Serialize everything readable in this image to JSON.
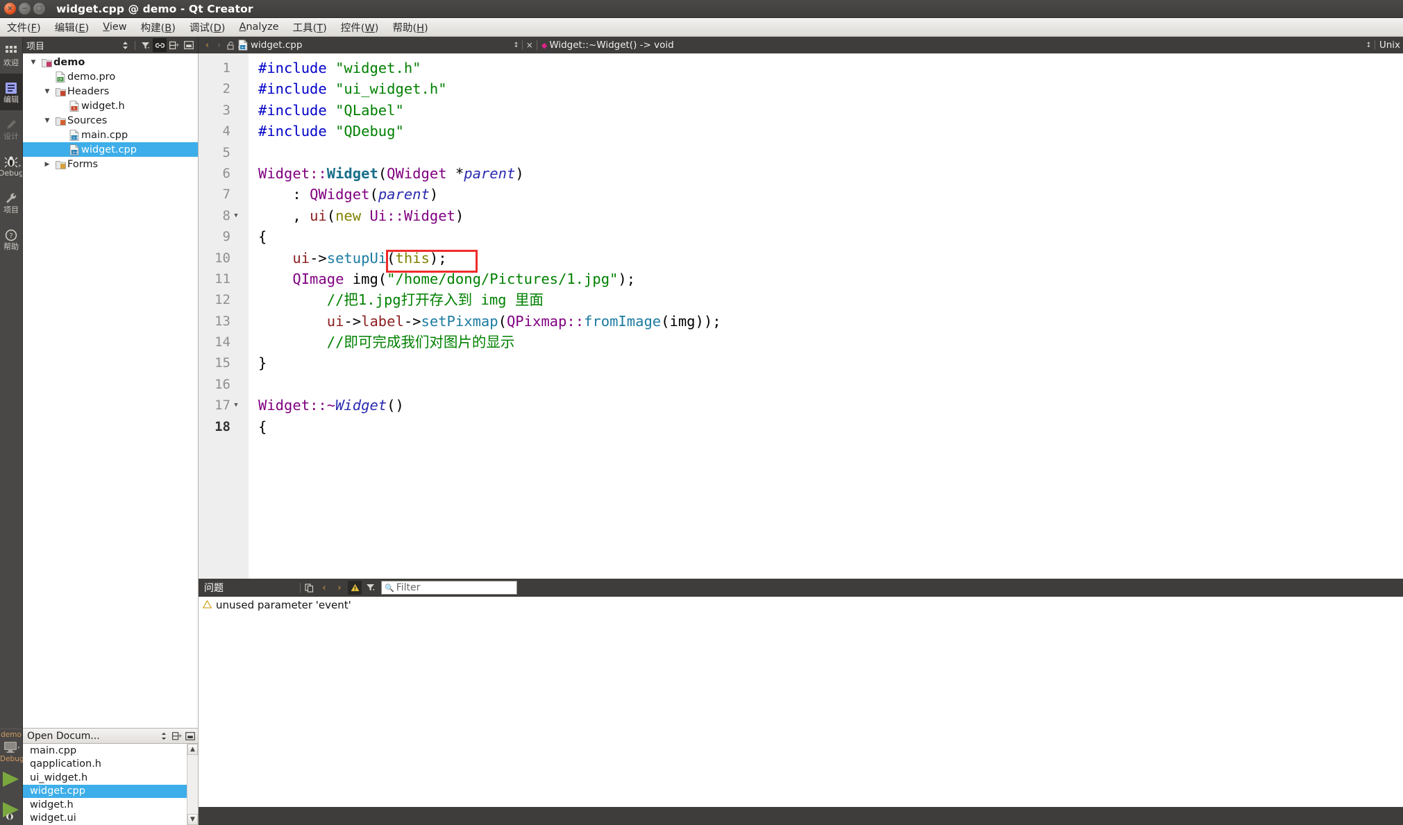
{
  "window": {
    "title": "widget.cpp @ demo - Qt Creator",
    "buttons": {
      "close": "close-button",
      "minimize": "minimize-button",
      "maximize": "maximize-button"
    }
  },
  "menubar": [
    {
      "label": "文件(F)",
      "mnemonic": "F"
    },
    {
      "label": "编辑(E)",
      "mnemonic": "E"
    },
    {
      "label": "View",
      "mnemonic": "V"
    },
    {
      "label": "构建(B)",
      "mnemonic": "B"
    },
    {
      "label": "调试(D)",
      "mnemonic": "D"
    },
    {
      "label": "Analyze",
      "mnemonic": "A"
    },
    {
      "label": "工具(T)",
      "mnemonic": "T"
    },
    {
      "label": "控件(W)",
      "mnemonic": "W"
    },
    {
      "label": "帮助(H)",
      "mnemonic": "H"
    }
  ],
  "modebar": {
    "items": [
      {
        "label": "欢迎",
        "icon": "grid-icon",
        "active": false
      },
      {
        "label": "编辑",
        "icon": "edit-document-icon",
        "active": true
      },
      {
        "label": "设计",
        "icon": "pencil-icon",
        "active": false,
        "disabled": true
      },
      {
        "label": "Debug",
        "icon": "bug-icon",
        "active": false
      },
      {
        "label": "项目",
        "icon": "wrench-icon",
        "active": false
      },
      {
        "label": "帮助",
        "icon": "question-icon",
        "active": false
      }
    ],
    "kit": {
      "project": "demo",
      "buildconfig": "Debug",
      "icon": "desktop-icon"
    },
    "run_button": "run-icon",
    "debug_button": "start-debugging-icon"
  },
  "sidebar": {
    "header": {
      "title": "项目",
      "tools": [
        "sort-updown-icon",
        "filter-icon",
        "link-icon",
        "split-icon",
        "close-icon"
      ]
    },
    "tree": [
      {
        "label": "demo",
        "indent": 0,
        "twist": "down",
        "icon": "qt-project-icon",
        "bold": true,
        "selected": false
      },
      {
        "label": "demo.pro",
        "indent": 1,
        "twist": "",
        "icon": "pro-file-icon",
        "bold": false,
        "selected": false
      },
      {
        "label": "Headers",
        "indent": 1,
        "twist": "down",
        "icon": "headers-folder-icon",
        "bold": false,
        "selected": false
      },
      {
        "label": "widget.h",
        "indent": 2,
        "twist": "",
        "icon": "h-file-icon",
        "bold": false,
        "selected": false
      },
      {
        "label": "Sources",
        "indent": 1,
        "twist": "down",
        "icon": "sources-folder-icon",
        "bold": false,
        "selected": false
      },
      {
        "label": "main.cpp",
        "indent": 2,
        "twist": "",
        "icon": "cpp-file-icon",
        "bold": false,
        "selected": false
      },
      {
        "label": "widget.cpp",
        "indent": 2,
        "twist": "",
        "icon": "cpp-file-icon",
        "bold": false,
        "selected": true
      },
      {
        "label": "Forms",
        "indent": 1,
        "twist": "right",
        "icon": "forms-folder-icon",
        "bold": false,
        "selected": false
      }
    ],
    "opendocs": {
      "title": "Open Docum...",
      "tools": [
        "sort-updown-icon",
        "split-icon",
        "close-icon"
      ],
      "files": [
        {
          "label": "main.cpp",
          "selected": false
        },
        {
          "label": "qapplication.h",
          "selected": false
        },
        {
          "label": "ui_widget.h",
          "selected": false
        },
        {
          "label": "widget.cpp",
          "selected": true
        },
        {
          "label": "widget.h",
          "selected": false
        },
        {
          "label": "widget.ui",
          "selected": false
        }
      ]
    }
  },
  "editor": {
    "tabbar": {
      "back": "‹",
      "forward": "›",
      "lock_icon": "unlocked-icon",
      "file_icon": "cpp-file-icon",
      "filename": "widget.cpp",
      "updown": "↕",
      "close": "×",
      "bookmark_icon": "bookmark-diamond-icon",
      "symbol": "Widget::~Widget() -> void",
      "encoding_updown": "↕",
      "encoding": "Unix"
    },
    "current_line": 18,
    "lines": [
      {
        "n": 1,
        "fold": "",
        "tokens": [
          {
            "t": "#include ",
            "c": "prep"
          },
          {
            "t": "\"widget.h\"",
            "c": "str"
          }
        ]
      },
      {
        "n": 2,
        "fold": "",
        "tokens": [
          {
            "t": "#include ",
            "c": "prep"
          },
          {
            "t": "\"ui_widget.h\"",
            "c": "str"
          }
        ]
      },
      {
        "n": 3,
        "fold": "",
        "tokens": [
          {
            "t": "#include ",
            "c": "prep"
          },
          {
            "t": "\"QLabel\"",
            "c": "str"
          }
        ]
      },
      {
        "n": 4,
        "fold": "",
        "tokens": [
          {
            "t": "#include ",
            "c": "prep"
          },
          {
            "t": "\"QDebug\"",
            "c": "str"
          }
        ]
      },
      {
        "n": 5,
        "fold": "",
        "tokens": []
      },
      {
        "n": 6,
        "fold": "",
        "tokens": [
          {
            "t": "Widget",
            "c": "cls"
          },
          {
            "t": "::",
            "c": "cls"
          },
          {
            "t": "Widget",
            "c": "fnb"
          },
          {
            "t": "(",
            "c": "pln"
          },
          {
            "t": "QWidget",
            "c": "cls"
          },
          {
            "t": " *",
            "c": "pln"
          },
          {
            "t": "parent",
            "c": "par"
          },
          {
            "t": ")",
            "c": "pln"
          }
        ]
      },
      {
        "n": 7,
        "fold": "",
        "tokens": [
          {
            "t": "    : ",
            "c": "pln"
          },
          {
            "t": "QWidget",
            "c": "cls"
          },
          {
            "t": "(",
            "c": "pln"
          },
          {
            "t": "parent",
            "c": "par"
          },
          {
            "t": ")",
            "c": "pln"
          }
        ]
      },
      {
        "n": 8,
        "fold": "down",
        "tokens": [
          {
            "t": "    , ",
            "c": "pln"
          },
          {
            "t": "ui",
            "c": "var"
          },
          {
            "t": "(",
            "c": "pln"
          },
          {
            "t": "new",
            "c": "kw"
          },
          {
            "t": " ",
            "c": "pln"
          },
          {
            "t": "Ui",
            "c": "cls"
          },
          {
            "t": "::",
            "c": "cls"
          },
          {
            "t": "Widget",
            "c": "cls"
          },
          {
            "t": ")",
            "c": "pln"
          }
        ]
      },
      {
        "n": 9,
        "fold": "",
        "tokens": [
          {
            "t": "{",
            "c": "pln"
          }
        ]
      },
      {
        "n": 10,
        "fold": "",
        "tokens": [
          {
            "t": "    ",
            "c": "pln"
          },
          {
            "t": "ui",
            "c": "var"
          },
          {
            "t": "->",
            "c": "pln"
          },
          {
            "t": "setupUi",
            "c": "fn"
          },
          {
            "t": "(",
            "c": "pln"
          },
          {
            "t": "this",
            "c": "kw"
          },
          {
            "t": ");",
            "c": "pln"
          }
        ]
      },
      {
        "n": 11,
        "fold": "",
        "tokens": [
          {
            "t": "    ",
            "c": "pln"
          },
          {
            "t": "QImage",
            "c": "cls"
          },
          {
            "t": " img(",
            "c": "pln"
          },
          {
            "t": "\"/home/dong/Pictures/1.jpg\"",
            "c": "str"
          },
          {
            "t": ");",
            "c": "pln"
          }
        ]
      },
      {
        "n": 12,
        "fold": "",
        "tokens": [
          {
            "t": "        //把1.jpg打开存入到 img 里面",
            "c": "cmt"
          }
        ]
      },
      {
        "n": 13,
        "fold": "",
        "tokens": [
          {
            "t": "        ",
            "c": "pln"
          },
          {
            "t": "ui",
            "c": "var"
          },
          {
            "t": "->",
            "c": "pln"
          },
          {
            "t": "label",
            "c": "var"
          },
          {
            "t": "->",
            "c": "pln"
          },
          {
            "t": "setPixmap",
            "c": "fn"
          },
          {
            "t": "(",
            "c": "pln"
          },
          {
            "t": "QPixmap",
            "c": "cls"
          },
          {
            "t": "::",
            "c": "cls"
          },
          {
            "t": "fromImage",
            "c": "fn"
          },
          {
            "t": "(img));",
            "c": "pln"
          }
        ]
      },
      {
        "n": 14,
        "fold": "",
        "tokens": [
          {
            "t": "        //即可完成我们对图片的显示",
            "c": "cmt"
          }
        ]
      },
      {
        "n": 15,
        "fold": "",
        "tokens": [
          {
            "t": "}",
            "c": "pln"
          }
        ]
      },
      {
        "n": 16,
        "fold": "",
        "tokens": []
      },
      {
        "n": 17,
        "fold": "down",
        "tokens": [
          {
            "t": "Widget",
            "c": "cls"
          },
          {
            "t": "::",
            "c": "cls"
          },
          {
            "t": "~",
            "c": "cls"
          },
          {
            "t": "Widget",
            "c": "par"
          },
          {
            "t": "()",
            "c": "pln"
          }
        ]
      },
      {
        "n": 18,
        "fold": "",
        "tokens": [
          {
            "t": "{",
            "c": "pln"
          }
        ]
      }
    ],
    "highlight_box": {
      "line": 10,
      "label": "setupUi-highlight"
    }
  },
  "issues": {
    "title": "问题",
    "tools": [
      "copy-icon",
      "prev-issue-icon",
      "next-issue-icon",
      "warning-filter-icon",
      "filter-icon"
    ],
    "filter_placeholder": "Filter",
    "filter_value": "",
    "rows": [
      {
        "severity": "warning",
        "icon": "warning-triangle-icon",
        "text": "unused parameter 'event'"
      }
    ]
  },
  "colors": {
    "accent_selection": "#3daee9",
    "chrome_dark": "#3f3d3b",
    "highlight_box": "#ef2b2b",
    "warning": "#e8c23a",
    "kit_text": "#d09a5e"
  }
}
